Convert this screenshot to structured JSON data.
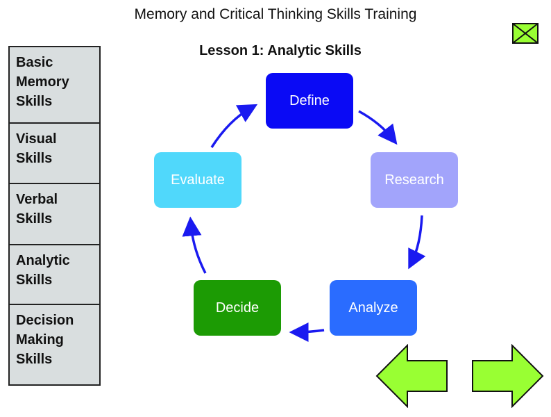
{
  "header": {
    "app_title": "Memory and Critical Thinking Skills Training",
    "close_icon": "close-x-icon"
  },
  "sidebar": {
    "items": [
      {
        "label": "Basic Memory Skills"
      },
      {
        "label": "Visual Skills"
      },
      {
        "label": "Verbal Skills"
      },
      {
        "label": "Analytic Skills"
      },
      {
        "label": "Decision Making Skills"
      }
    ]
  },
  "lesson": {
    "title": "Lesson 1: Analytic Skills",
    "steps": [
      {
        "label": "Define",
        "color": "#0a0af5"
      },
      {
        "label": "Research",
        "color": "#a2a4fb"
      },
      {
        "label": "Analyze",
        "color": "#2a6cff"
      },
      {
        "label": "Decide",
        "color": "#1c9b04"
      },
      {
        "label": "Evaluate",
        "color": "#50d8fb"
      }
    ],
    "cycle_arrow_color": "#1a1af0"
  },
  "navigation": {
    "back_icon": "arrow-left-icon",
    "next_icon": "arrow-right-icon",
    "accent_color": "#99ff33"
  }
}
